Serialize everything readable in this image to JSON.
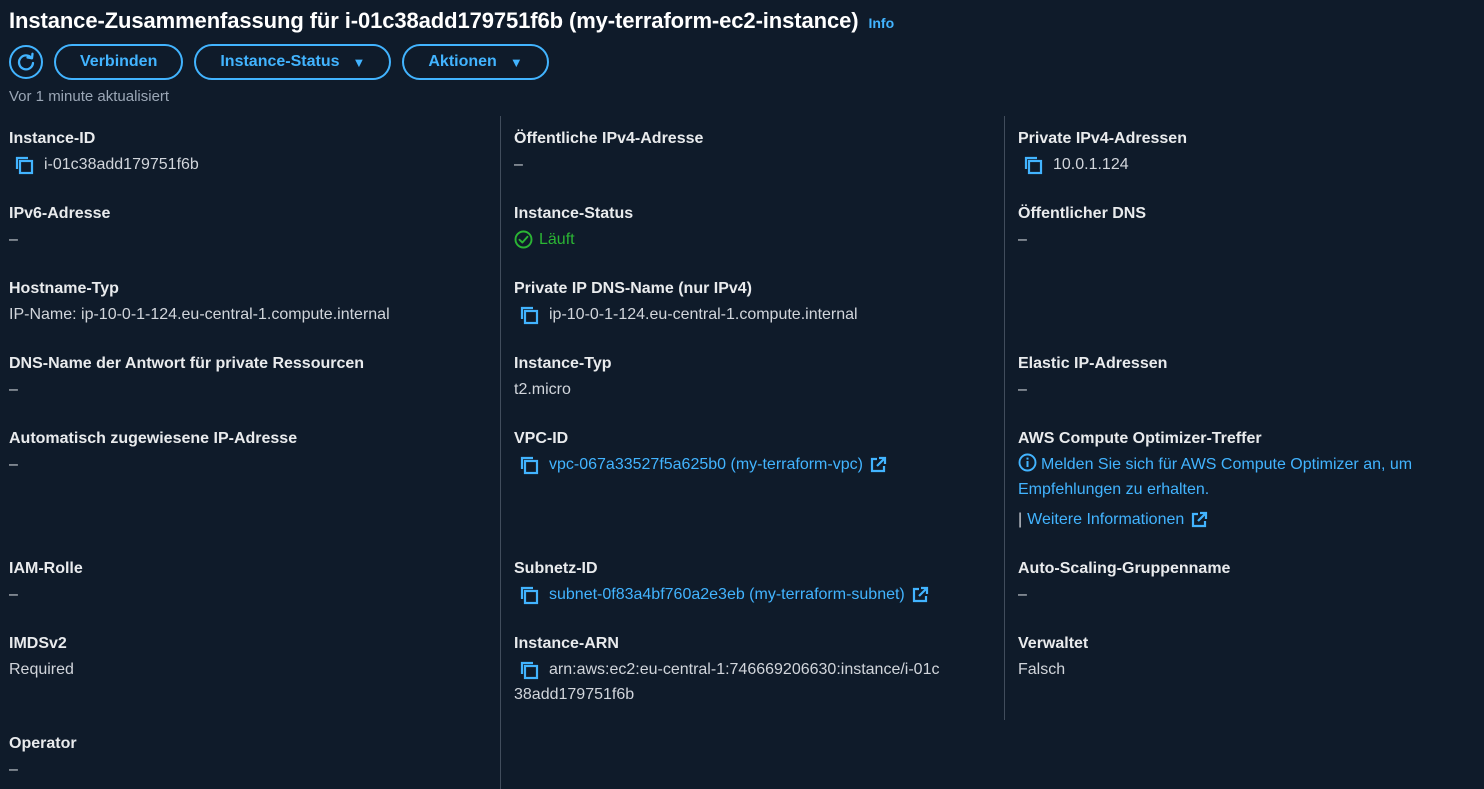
{
  "header": {
    "title": "Instance-Zusammenfassung für i-01c38add179751f6b (my-terraform-ec2-instance)",
    "info": "Info",
    "updated": "Vor 1 minute aktualisiert"
  },
  "toolbar": {
    "refresh_icon": "refresh-icon",
    "connect_label": "Verbinden",
    "status_label": "Instance-Status",
    "actions_label": "Aktionen"
  },
  "colors": {
    "background": "#0f1b2a",
    "accent": "#42b4ff",
    "running": "#2bb534",
    "divider": "#414d5c"
  },
  "fields": {
    "instance_id": {
      "label": "Instance-ID",
      "value": "i-01c38add179751f6b"
    },
    "public_ipv4": {
      "label": "Öffentliche IPv4-Adresse",
      "value": "–"
    },
    "private_ipv4": {
      "label": "Private IPv4-Adressen",
      "value": "10.0.1.124"
    },
    "ipv6": {
      "label": "IPv6-Adresse",
      "value": "–"
    },
    "instance_status": {
      "label": "Instance-Status",
      "value": "Läuft"
    },
    "public_dns": {
      "label": "Öffentlicher DNS",
      "value": "–"
    },
    "hostname_type": {
      "label": "Hostname-Typ",
      "value": "IP-Name: ip-10-0-1-124.eu-central-1.compute.internal"
    },
    "private_dns": {
      "label": "Private IP DNS-Name (nur IPv4)",
      "value": "ip-10-0-1-124.eu-central-1.compute.internal"
    },
    "answer_dns": {
      "label": "DNS-Name der Antwort für private Ressourcen",
      "value": "–"
    },
    "instance_type": {
      "label": "Instance-Typ",
      "value": "t2.micro"
    },
    "elastic_ip": {
      "label": "Elastic IP-Adressen",
      "value": "–"
    },
    "auto_ip": {
      "label": "Automatisch zugewiesene IP-Adresse",
      "value": "–"
    },
    "vpc_id": {
      "label": "VPC-ID",
      "value": "vpc-067a33527f5a625b0 (my-terraform-vpc)"
    },
    "optimizer": {
      "label": "AWS Compute Optimizer-Treffer",
      "message": "Melden Sie sich für AWS Compute Optimizer an, um Empfehlungen zu erhalten.",
      "separator": "|",
      "more_info": "Weitere Informationen"
    },
    "iam_role": {
      "label": "IAM-Rolle",
      "value": "–"
    },
    "subnet_id": {
      "label": "Subnetz-ID",
      "value": "subnet-0f83a4bf760a2e3eb (my-terraform-subnet)"
    },
    "asg_name": {
      "label": "Auto-Scaling-Gruppenname",
      "value": "–"
    },
    "imdsv2": {
      "label": "IMDSv2",
      "value": "Required"
    },
    "instance_arn": {
      "label": "Instance-ARN",
      "value_line1": "arn:aws:ec2:eu-central-1:746669206630:instance/i-01c",
      "value_line2": "38add179751f6b"
    },
    "managed": {
      "label": "Verwaltet",
      "value": "Falsch"
    },
    "operator": {
      "label": "Operator",
      "value": "–"
    }
  }
}
